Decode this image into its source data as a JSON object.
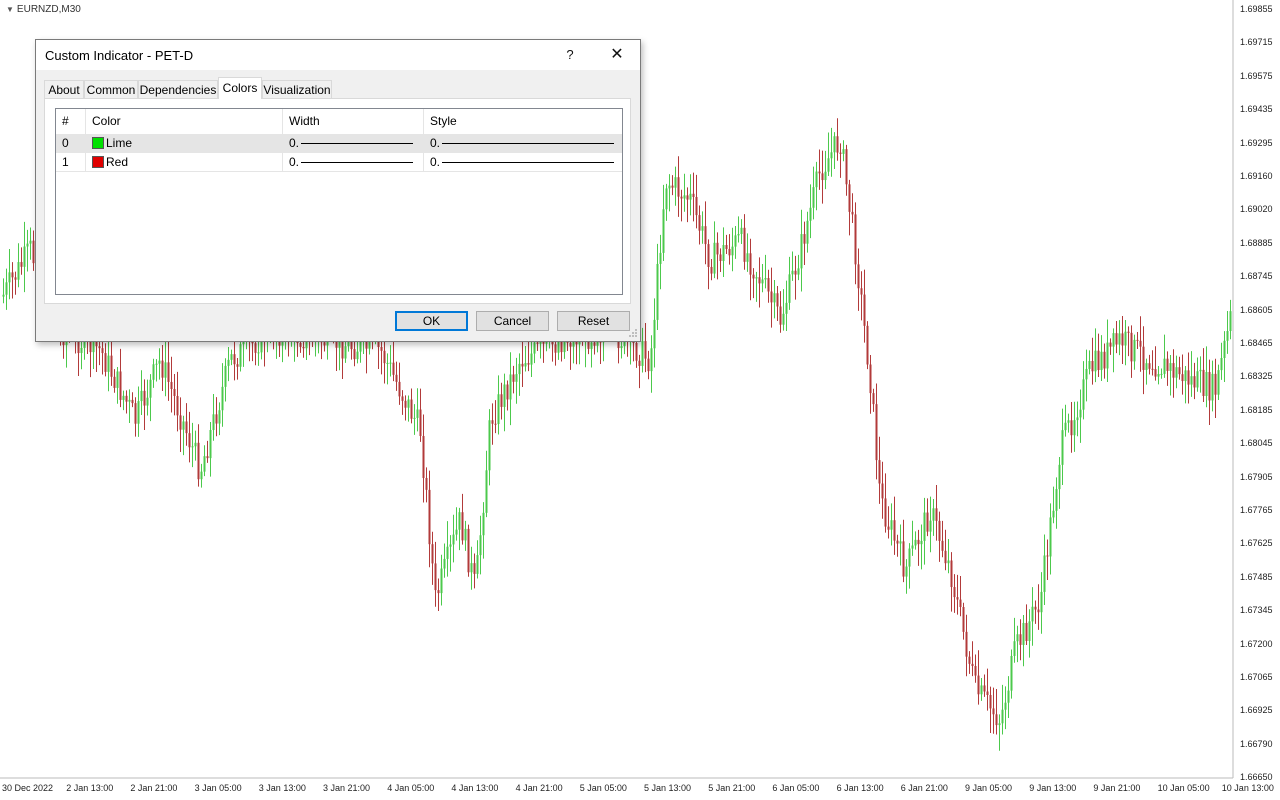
{
  "chart": {
    "symbol": "EURNZD,M30",
    "colors": {
      "bull": "#4cc94c",
      "bear": "#b23a3a"
    },
    "price_levels": [
      "1.69855",
      "1.69715",
      "1.69575",
      "1.69435",
      "1.69295",
      "1.69160",
      "1.69020",
      "1.68885",
      "1.68745",
      "1.68605",
      "1.68465",
      "1.68325",
      "1.68185",
      "1.68045",
      "1.67905",
      "1.67765",
      "1.67625",
      "1.67485",
      "1.67345",
      "1.67200",
      "1.67065",
      "1.66925",
      "1.66790",
      "1.66650"
    ],
    "time_labels": [
      "30 Dec 2022",
      "2 Jan 13:00",
      "2 Jan 21:00",
      "3 Jan 05:00",
      "3 Jan 13:00",
      "3 Jan 21:00",
      "4 Jan 05:00",
      "4 Jan 13:00",
      "4 Jan 21:00",
      "5 Jan 05:00",
      "5 Jan 13:00",
      "5 Jan 21:00",
      "6 Jan 05:00",
      "6 Jan 13:00",
      "6 Jan 21:00",
      "9 Jan 05:00",
      "9 Jan 13:00",
      "9 Jan 21:00",
      "10 Jan 05:00",
      "10 Jan 13:00"
    ]
  },
  "dialog": {
    "title": "Custom Indicator - PET-D",
    "help": "?",
    "close": "✕",
    "tabs": [
      "About",
      "Common",
      "Dependencies",
      "Colors",
      "Visualization"
    ],
    "active_tab": "Colors",
    "columns": [
      "#",
      "Color",
      "Width",
      "Style"
    ],
    "rows": [
      {
        "index": "0",
        "color_name": "Lime",
        "color_hex": "#00e000",
        "width": "0.",
        "style": ""
      },
      {
        "index": "1",
        "color_name": "Red",
        "color_hex": "#e00000",
        "width": "0.",
        "style": ""
      }
    ],
    "buttons": {
      "ok": "OK",
      "cancel": "Cancel",
      "reset": "Reset"
    }
  }
}
